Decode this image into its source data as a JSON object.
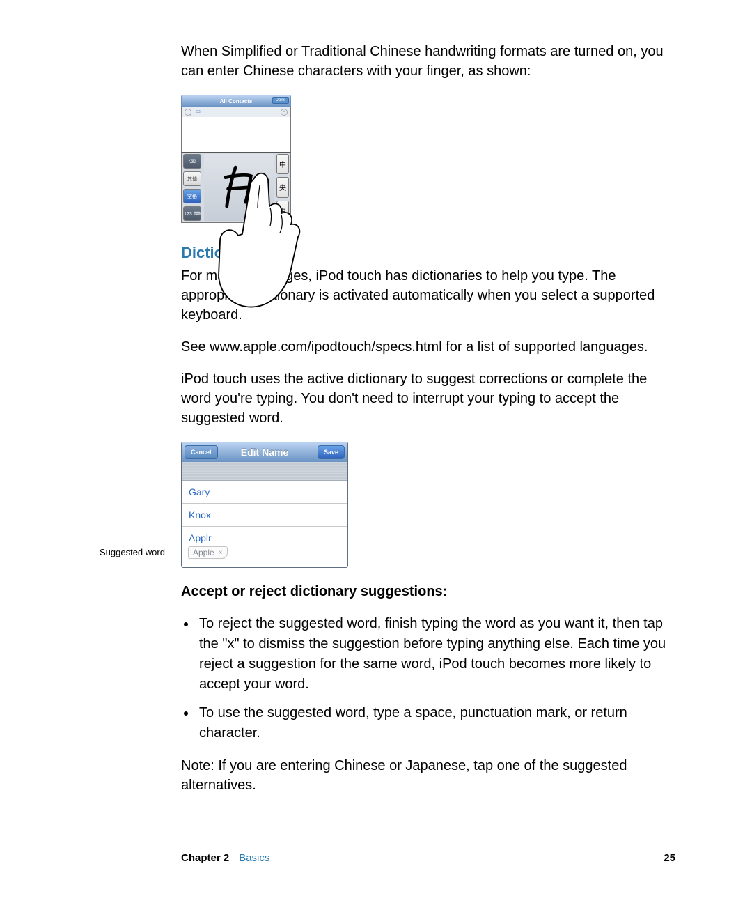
{
  "para1": "When Simplified or Traditional Chinese handwriting formats are turned on, you can enter Chinese characters with your finger, as shown:",
  "hw": {
    "title": "All Contacts",
    "done": "Done",
    "search_char": "中",
    "keys": {
      "back": "⌫",
      "other": "其他",
      "space": "空格",
      "num": "123 ⌨"
    },
    "suggestions": [
      "中",
      "央",
      "虫"
    ]
  },
  "section_heading": "Dictionary",
  "para2": "For many languages, iPod touch has dictionaries to help you type. The appropriate dictionary is activated automatically when you select a supported keyboard.",
  "para3a": "See ",
  "para3b": "www.apple.com/ipodtouch/specs.html",
  "para3c": " for a list of supported languages.",
  "para4": "iPod touch uses the active dictionary to suggest corrections or complete the word you're typing. You don't need to interrupt your typing to accept the suggested word.",
  "en": {
    "cancel": "Cancel",
    "title": "Edit Name",
    "save": "Save",
    "rows": [
      "Gary",
      "Knox",
      "Applr"
    ],
    "suggestion": "Apple",
    "label": "Suggested word"
  },
  "subhead": "Accept or reject dictionary suggestions:",
  "bul1a": "To reject the suggested word,",
  "bul1b": " finish typing the word as you want it, then tap the \"x\" to dismiss the suggestion before typing anything else. Each time you reject a suggestion for the same word, iPod touch becomes more likely to accept your word.",
  "bul2a": "To use the suggested word,",
  "bul2b": " type a space, punctuation mark, or return character.",
  "noteA": "Note:",
  "noteB": "  If you are entering Chinese or Japanese, tap one of the suggested alternatives.",
  "footer": {
    "chapter": "Chapter 2",
    "section": "Basics",
    "page": "25"
  }
}
